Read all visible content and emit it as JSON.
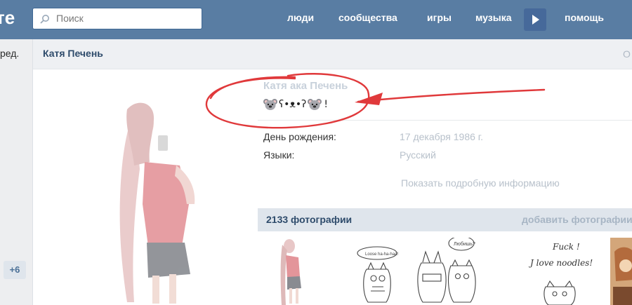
{
  "header": {
    "logo": "те",
    "search_placeholder": "Поиск",
    "nav": [
      {
        "label": "люди"
      },
      {
        "label": "сообщества"
      },
      {
        "label": "игры"
      },
      {
        "label": "музыка"
      },
      {
        "label": "помощь"
      }
    ]
  },
  "sidebar": {
    "stub_text": "ред.",
    "badge": "+6"
  },
  "page": {
    "title": "Катя Печень",
    "right_stub": "О"
  },
  "profile": {
    "name": "Катя ака Печень",
    "status_middle": "ʕ•ᴥ•ʔ",
    "status_end": "!",
    "info": [
      {
        "label": "День рождения:",
        "value": "17 декабря 1986 г."
      },
      {
        "label": "Языки:",
        "value": "Русский"
      }
    ],
    "more_info": "Показать подробную информацию"
  },
  "photos": {
    "title": "2133 фотографии",
    "add": "добавить фотографии",
    "sketch_texts": [
      "Fuck !",
      "J love noodles!",
      "Любишь?",
      "Loose ha-ha-haa!"
    ]
  },
  "colors": {
    "header_bg": "#597da3",
    "accent_link": "#2e4b6b",
    "annotation": "#e0393b"
  }
}
